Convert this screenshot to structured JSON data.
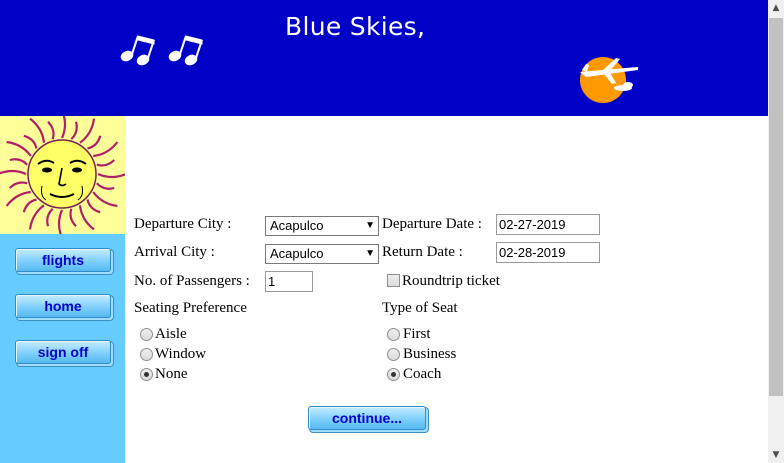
{
  "header": {
    "title": "Blue Skies,"
  },
  "sidebar": {
    "buttons": [
      {
        "label": "flights"
      },
      {
        "label": "home"
      },
      {
        "label": "sign off"
      }
    ]
  },
  "form": {
    "departure_city": {
      "label": "Departure City :",
      "value": "Acapulco"
    },
    "departure_date": {
      "label": "Departure Date :",
      "value": "02-27-2019"
    },
    "arrival_city": {
      "label": "Arrival City :",
      "value": "Acapulco"
    },
    "return_date": {
      "label": "Return Date :",
      "value": "02-28-2019"
    },
    "passengers": {
      "label": "No. of Passengers :",
      "value": "1"
    },
    "roundtrip": {
      "label": "Roundtrip ticket",
      "checked": false
    },
    "seating_preference": {
      "label": "Seating Preference",
      "options": [
        {
          "label": "Aisle",
          "selected": false
        },
        {
          "label": "Window",
          "selected": false
        },
        {
          "label": "None",
          "selected": true
        }
      ]
    },
    "seat_type": {
      "label": "Type of Seat",
      "options": [
        {
          "label": "First",
          "selected": false
        },
        {
          "label": "Business",
          "selected": false
        },
        {
          "label": "Coach",
          "selected": true
        }
      ]
    },
    "continue_label": "continue..."
  },
  "colors": {
    "header": "#0000c6",
    "sidebar": "#66ccff",
    "button_text": "#0000cc"
  }
}
